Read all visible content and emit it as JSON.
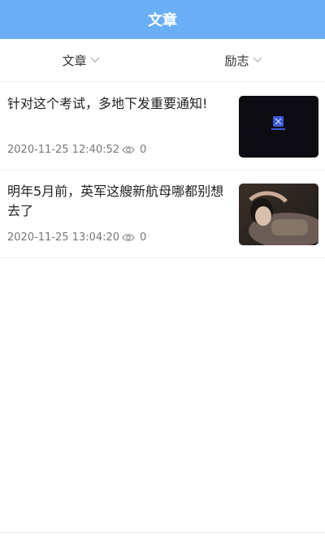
{
  "header": {
    "title": "文章"
  },
  "filters": [
    {
      "label": "文章",
      "icon": "chevron-down-icon"
    },
    {
      "label": "励志",
      "icon": "chevron-down-icon"
    }
  ],
  "articles": [
    {
      "title": "针对这个考试，多地下发重要通知!",
      "date": "2020-11-25 12:40:52",
      "views": "0",
      "thumbnail": "dark-logo-image"
    },
    {
      "title": "明年5月前，英军这艘新航母哪都别想去了",
      "date": "2020-11-25 13:04:20",
      "views": "0",
      "thumbnail": "person-lying-photo"
    }
  ],
  "colors": {
    "header_bg": "#6aaef5",
    "accent_logo": "#3b5bd6"
  }
}
